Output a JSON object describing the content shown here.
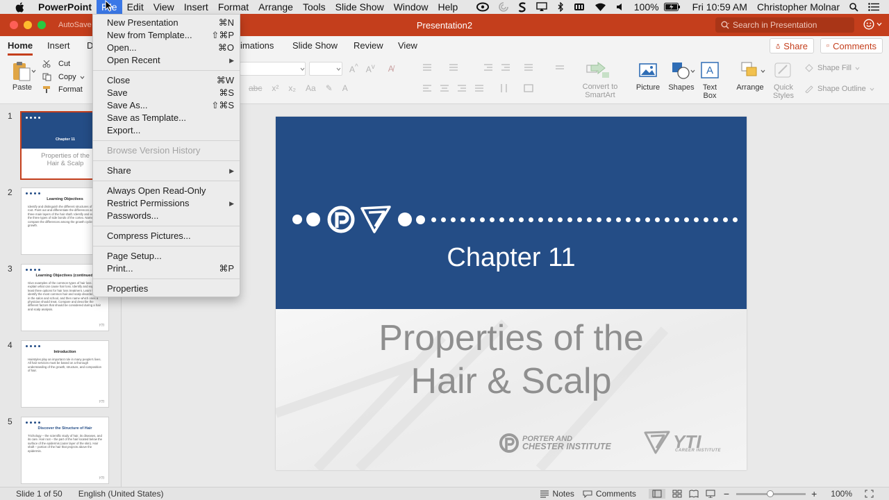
{
  "menubar": {
    "app_name": "PowerPoint",
    "items": [
      "File",
      "Edit",
      "View",
      "Insert",
      "Format",
      "Arrange",
      "Tools",
      "Slide Show",
      "Window",
      "Help"
    ],
    "battery": "100%",
    "clock": "Fri 10:59 AM",
    "user": "Christopher Molnar"
  },
  "window": {
    "autosave_label": "AutoSave",
    "title": "Presentation2",
    "search_placeholder": "Search in Presentation"
  },
  "ribbon_tabs": {
    "home": "Home",
    "insert": "Insert",
    "design": "D",
    "animations": "imations",
    "slideshow": "Slide Show",
    "review": "Review",
    "view": "View",
    "share": "Share",
    "comments": "Comments"
  },
  "ribbon": {
    "paste": "Paste",
    "cut": "Cut",
    "copy": "Copy",
    "format": "Format",
    "convert_smartart_1": "Convert to",
    "convert_smartart_2": "SmartArt",
    "picture": "Picture",
    "shapes": "Shapes",
    "textbox_1": "Text",
    "textbox_2": "Box",
    "arrange": "Arrange",
    "quick_styles_1": "Quick",
    "quick_styles_2": "Styles",
    "shape_fill": "Shape Fill",
    "shape_outline": "Shape Outline"
  },
  "file_menu": {
    "new_presentation": "New Presentation",
    "new_presentation_sc": "⌘N",
    "new_from_template": "New from Template...",
    "new_from_template_sc": "⇧⌘P",
    "open": "Open...",
    "open_sc": "⌘O",
    "open_recent": "Open Recent",
    "close": "Close",
    "close_sc": "⌘W",
    "save": "Save",
    "save_sc": "⌘S",
    "save_as": "Save As...",
    "save_as_sc": "⇧⌘S",
    "save_as_template": "Save as Template...",
    "export": "Export...",
    "browse_version_history": "Browse Version History",
    "share": "Share",
    "always_open_read_only": "Always Open Read-Only",
    "restrict_permissions": "Restrict Permissions",
    "passwords": "Passwords...",
    "compress_pictures": "Compress Pictures...",
    "page_setup": "Page Setup...",
    "print": "Print...",
    "print_sc": "⌘P",
    "properties": "Properties"
  },
  "thumbnails": [
    {
      "num": "1",
      "title": "Chapter 11",
      "subtitle_1": "Properties of the",
      "subtitle_2": "Hair & Scalp"
    },
    {
      "num": "2",
      "title": "Learning Objectives",
      "body": "Identify and distinguish the different structures of the hair root. Point out and differentiate the differences among the three main layers of the hair shaft. Identify and explain the three types of side bonds of the cortex. Name and compare the differences among the growth cycles of hair growth."
    },
    {
      "num": "3",
      "title": "Learning Objectives (continued)",
      "body": "Give examples of the common types of hair loss and explain what can cause hair loss. Identify and explain at least three options for hair loss treatment. Learn to identify the most common hair and scalp disorders seen in the salon and school, and then name which ones a physician should treat. Compare and describe the different factors that should be considered during a hair and scalp analysis."
    },
    {
      "num": "4",
      "title": "Introduction",
      "body": "Hairstyles play an important role in many people's lives. All hair services must be based on a thorough understanding of the growth, structure, and composition of hair."
    },
    {
      "num": "5",
      "title": "Discover the Structure of Hair",
      "body": "Trichology – the scientific study of hair, its diseases, and its care. Hair root – the part of the hair located below the surface of the epidermis (outer layer of the skin). Hair shaft – portion of the hair that projects above the epidermis."
    }
  ],
  "slide": {
    "chapter": "Chapter 11",
    "title_line1": "Properties of the",
    "title_line2": "Hair & Scalp",
    "brand1_line1": "PORTER AND",
    "brand1_line2": "CHESTER INSTITUTE",
    "brand2": "YTI",
    "brand2_sub": "CAREER INSTITUTE",
    "thumb_brand": "YTI"
  },
  "statusbar": {
    "slide_info": "Slide 1 of 50",
    "language": "English (United States)",
    "notes": "Notes",
    "comments": "Comments",
    "zoom": "100%"
  },
  "colors": {
    "accent": "#c43e1c",
    "slide_blue": "#244d86",
    "menu_highlight": "#3b78e7"
  }
}
